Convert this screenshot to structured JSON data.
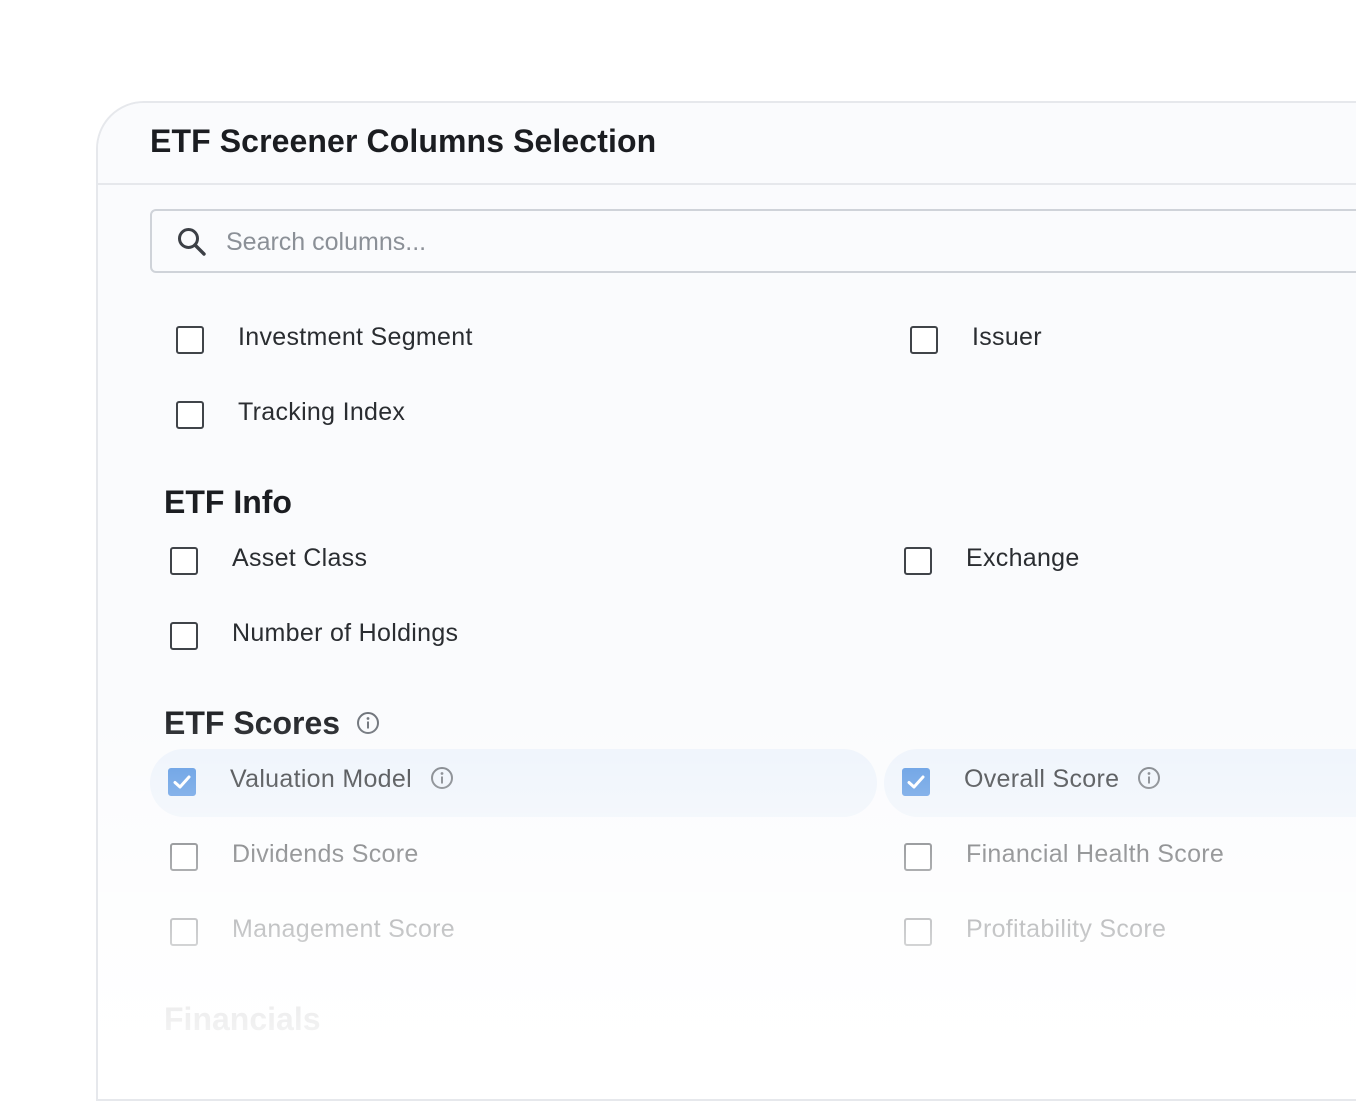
{
  "dialog": {
    "title": "ETF Screener Columns Selection"
  },
  "search": {
    "placeholder": "Search columns...",
    "icon": "search-icon"
  },
  "general": {
    "items": [
      {
        "label": "Investment Segment",
        "checked": false
      },
      {
        "label": "Issuer",
        "checked": false
      },
      {
        "label": "Tracking Index",
        "checked": false
      }
    ]
  },
  "etf_info": {
    "title": "ETF Info",
    "items": [
      {
        "label": "Asset Class",
        "checked": false
      },
      {
        "label": "Exchange",
        "checked": false
      },
      {
        "label": "Number of Holdings",
        "checked": false
      }
    ]
  },
  "etf_scores": {
    "title": "ETF Scores",
    "items": [
      {
        "label": "Valuation Model",
        "checked": true,
        "info": true
      },
      {
        "label": "Overall Score",
        "checked": true,
        "info": true
      },
      {
        "label": "Dividends Score",
        "checked": false
      },
      {
        "label": "Financial Health Score",
        "checked": false
      },
      {
        "label": "Management Score",
        "checked": false
      },
      {
        "label": "Profitability Score",
        "checked": false
      }
    ]
  },
  "financials": {
    "title": "Financials"
  },
  "colors": {
    "checkbox_checked": "#4d8fe0",
    "selected_row": "#edf3fb",
    "text": "#2a2d31"
  }
}
